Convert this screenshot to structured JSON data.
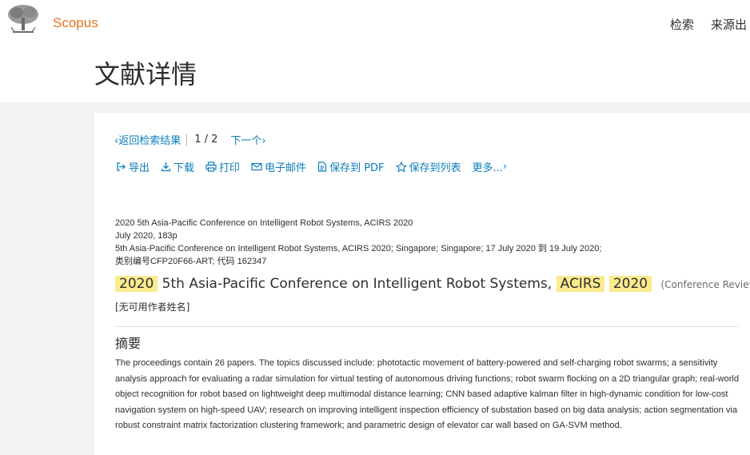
{
  "header": {
    "brand": "Scopus",
    "nav_search": "检索",
    "nav_sources": "来源出",
    "page_title": "文献详情"
  },
  "navigation": {
    "back_label": "返回检索结果",
    "pager": "1 / 2",
    "next_label": "下一个"
  },
  "actions": {
    "export": "导出",
    "download": "下载",
    "print": "打印",
    "email": "电子邮件",
    "save_pdf": "保存到 PDF",
    "save_list": "保存到列表",
    "more": "更多..."
  },
  "document": {
    "meta_line1": "2020 5th Asia-Pacific Conference on Intelligent Robot Systems, ACIRS 2020",
    "meta_line2": "July 2020, 183p",
    "meta_line3": "5th Asia-Pacific Conference on Intelligent Robot Systems, ACIRS 2020; Singapore; Singapore; 17 July 2020 到 19 July 2020;",
    "meta_line4": "类别编号CFP20F66-ART; 代码 162347",
    "title_parts": {
      "year": "2020",
      "middle": "5th Asia-Pacific Conference on Intelligent Robot Systems,",
      "acronym": "ACIRS",
      "year2": "2020"
    },
    "doc_type": "(Conference Review)",
    "authors": "[无可用作者姓名]"
  },
  "abstract": {
    "heading": "摘要",
    "text": "The proceedings contain 26 papers. The topics discussed include: phototactic movement of battery-powered and self-charging robot swarms; a sensitivity analysis approach for evaluating a radar simulation for virtual testing of autonomous driving functions; robot swarm flocking on a 2D triangular graph; real-world object recognition for robot based on lightweight deep multimodal distance learning; CNN based adaptive kalman filter in high-dynamic condition for low-cost navigation system on high-speed UAV; research on improving intelligent inspection efficiency of substation based on big data analysis; action segmentation via robust constraint matrix factorization clustering framework; and parametric design of elevator car wall based on GA-SVM method."
  },
  "colors": {
    "brand_orange": "#e9711c",
    "link_blue": "#0c7dbb",
    "highlight_yellow": "#fbeb8e"
  }
}
